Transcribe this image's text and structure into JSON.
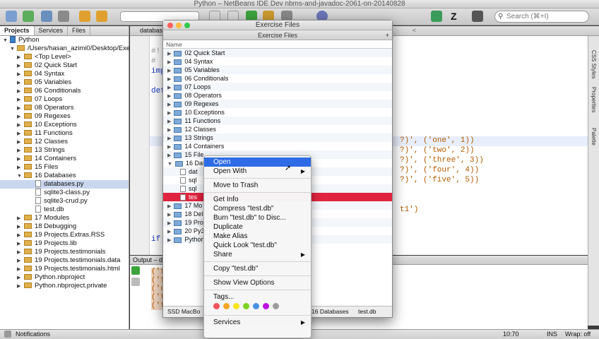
{
  "window": {
    "title": "Python – NetBeans IDE Dev nbms-and-javadoc-2061-on-20140828"
  },
  "search": {
    "placeholder": "Search (⌘+I)"
  },
  "projects": {
    "tabs": [
      "Projects",
      "Services",
      "Files"
    ],
    "root": "Python",
    "path": "/Users/hasan_azimi0/Desktop/Exercise",
    "items": [
      "<Top Level>",
      "02 Quick Start",
      "04 Syntax",
      "05 Variables",
      "06 Conditionals",
      "07 Loops",
      "08 Operators",
      "09 Regexes",
      "10 Exceptions",
      "11 Functions",
      "12 Classes",
      "13 Strings",
      "14 Containers",
      "15 Files",
      "16 Databases",
      "databases.py",
      "sqlite3-class.py",
      "sqlite3-crud.py",
      "test.db",
      "17 Modules",
      "18 Debugging",
      "19 Projects.Extras.RSS",
      "19 Projects.lib",
      "19 Projects.testimonials",
      "19 Projects.testimonials.data",
      "19 Projects.testimonials.html",
      "Python.nbproject",
      "Python.nbproject.private"
    ]
  },
  "editor": {
    "tab": "databases",
    "lines": [
      "#!",
      "# ",
      "imp",
      "def",
      "if "
    ],
    "code_right": [
      "?)', ('one', 1))",
      "?)', ('two', 2))",
      "?)', ('three', 3))",
      "?)', ('four', 4))",
      "?)', ('five', 5))",
      "t1')"
    ],
    "tab_right": "<"
  },
  "right_panels": [
    "CSS Styles",
    "Properties",
    "Palette"
  ],
  "output": {
    "tab": "Output – dat",
    "lines": [
      "('f",
      "('f",
      "('o",
      "('t",
      "('t"
    ]
  },
  "status": {
    "notifications": "Notifications",
    "position": "10:70",
    "mode": "INS",
    "wrap": "Wrap: off"
  },
  "finder": {
    "title": "Exercise Files",
    "subtitle": "Exercise Files",
    "column": "Name",
    "rows": [
      "02 Quick Start",
      "04 Syntax",
      "05 Variables",
      "06 Conditionals",
      "07 Loops",
      "08 Operators",
      "09 Regexes",
      "10 Exceptions",
      "11 Functions",
      "12 Classes",
      "13 Strings",
      "14 Containers",
      "15 File",
      "16 Dat",
      "dat",
      "sql",
      "sql",
      "tes",
      "17 Mo",
      "18 Del",
      "19 Pro",
      "20 Py3",
      "Python"
    ],
    "path": [
      "SSD MacBo",
      "16 Databases",
      "test.db"
    ]
  },
  "context_menu": {
    "items": [
      "Open",
      "Open With",
      "Move to Trash",
      "Get Info",
      "Compress \"test.db\"",
      "Burn \"test.db\" to Disc...",
      "Duplicate",
      "Make Alias",
      "Quick Look \"test.db\"",
      "Share",
      "Copy \"test.db\"",
      "Show View Options",
      "Tags...",
      "Services"
    ],
    "tag_colors": [
      "#f2545b",
      "#f5a623",
      "#f8e71c",
      "#7ed321",
      "#4a90e2",
      "#bd10e0",
      "#9b9b9b"
    ]
  }
}
